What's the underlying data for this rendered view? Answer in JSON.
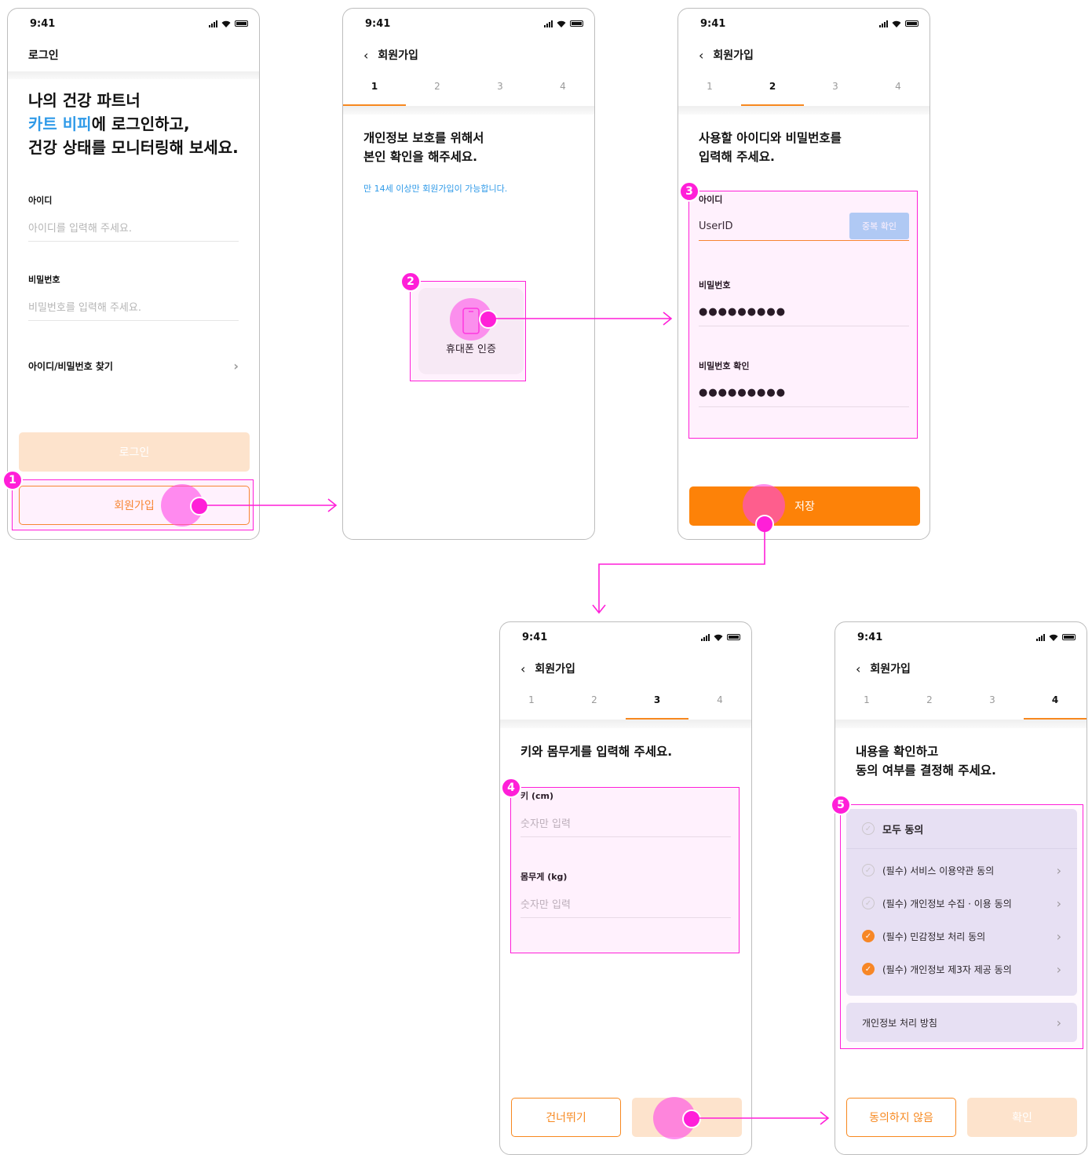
{
  "status_time": "9:41",
  "screen1": {
    "header": "로그인",
    "headline_line1": "나의 건강 파트너",
    "headline_brand": "카트 비피",
    "headline_line2_rest": "에 로그인하고,",
    "headline_line3": "건강 상태를 모니터링해 보세요.",
    "id_label": "아이디",
    "id_placeholder": "아이디를 입력해 주세요.",
    "pw_label": "비밀번호",
    "pw_placeholder": "비밀번호를 입력해 주세요.",
    "find_link": "아이디/비밀번호 찾기",
    "login_button": "로그인",
    "signup_button": "회원가입",
    "badge": "1"
  },
  "signup_header": "회원가입",
  "steps": [
    "1",
    "2",
    "3",
    "4"
  ],
  "screen2": {
    "title_line1": "개인정보 보호를 위해서",
    "title_line2": "본인 확인을 해주세요.",
    "notice": "만 14세 이상만 회원가입이 가능합니다.",
    "phone_verify": "휴대폰 인증",
    "badge": "2"
  },
  "screen3": {
    "title_line1": "사용할 아이디와 비밀번호를",
    "title_line2": "입력해 주세요.",
    "id_label": "아이디",
    "id_value": "UserID",
    "dup_check": "중복 확인",
    "pw_label": "비밀번호",
    "pw_value": "●●●●●●●●●",
    "pw_confirm_label": "비밀번호 확인",
    "pw_confirm_value": "●●●●●●●●●",
    "save_button": "저장",
    "badge": "3"
  },
  "screen4": {
    "title": "키와 몸무게를 입력해 주세요.",
    "height_label": "키 (cm)",
    "height_placeholder": "숫자만 입력",
    "weight_label": "몸무게 (kg)",
    "weight_placeholder": "숫자만 입력",
    "skip_button": "건너뛰기",
    "badge": "4"
  },
  "screen5": {
    "title_line1": "내용을 확인하고",
    "title_line2": "동의 여부를 결정해 주세요.",
    "agree_all": "모두 동의",
    "items": [
      {
        "label": "(필수) 서비스 이용약관 동의",
        "checked": false
      },
      {
        "label": "(필수) 개인정보 수집 · 이용 동의",
        "checked": false
      },
      {
        "label": "(필수) 민감정보 처리 동의",
        "checked": true
      },
      {
        "label": "(필수) 개인정보 제3자 제공 동의",
        "checked": true
      }
    ],
    "policy": "개인정보 처리 방침",
    "disagree_button": "동의하지 않음",
    "confirm_button": "확인",
    "badge": "5"
  },
  "colors": {
    "accent": "#f7881f",
    "brand_blue": "#2f9ae8",
    "annotation": "#ff1fd8",
    "disabled_orange": "#fde3cc",
    "agree_panel": "#e6e4f4"
  }
}
